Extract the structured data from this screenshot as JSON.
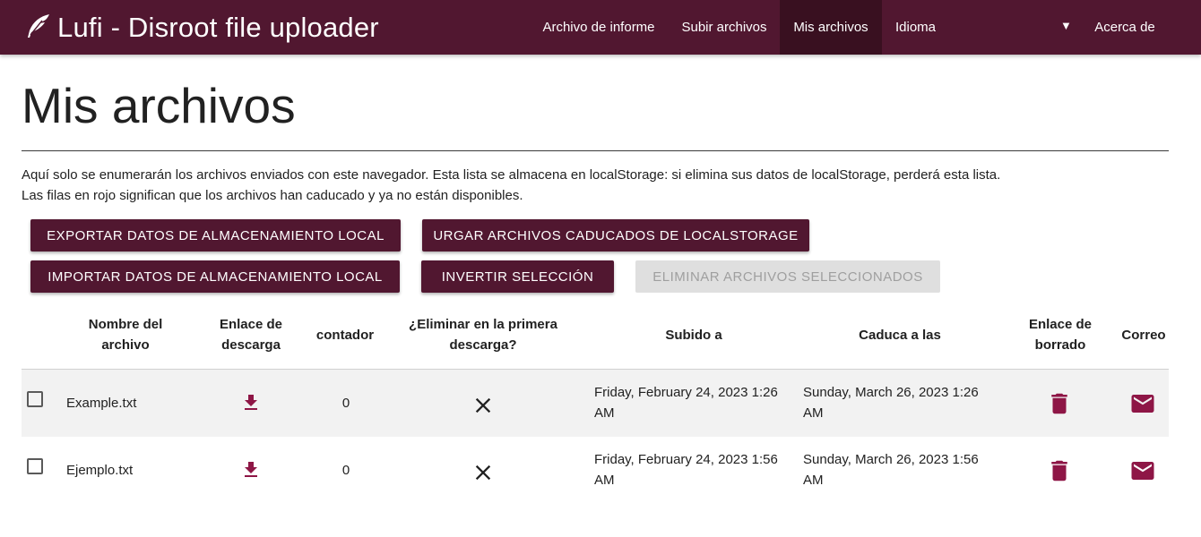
{
  "nav": {
    "brand": "Lufi - Disroot file uploader",
    "items": [
      {
        "label": "Archivo de informe"
      },
      {
        "label": "Subir archivos"
      },
      {
        "label": "Mis archivos",
        "active": true
      },
      {
        "label": "Acerca de"
      }
    ],
    "language": {
      "label": "Idioma",
      "caret": "▼"
    }
  },
  "page": {
    "title": "Mis archivos",
    "info_line1": "Aquí solo se enumerarán los archivos enviados con este navegador. Esta lista se almacena en localStorage: si elimina sus datos de localStorage, perderá esta lista.",
    "info_line2": "Las filas en rojo significan que los archivos han caducado y ya no están disponibles."
  },
  "buttons": {
    "export": "Exportar datos de almacenamiento local",
    "purge": "Urgar archivos caducados de localStorage",
    "import": "Importar datos de almacenamiento local",
    "invert": "Invertir selección",
    "delete_selected": "Eliminar archivos seleccionados"
  },
  "table": {
    "headers": {
      "name": [
        "Nombre del",
        "archivo"
      ],
      "download": [
        "Enlace de",
        "descarga"
      ],
      "counter": "contador",
      "delete_first": [
        "¿Eliminar en la primera",
        "descarga?"
      ],
      "uploaded": "Subido a",
      "expires": "Caduca a las",
      "deletion_link": [
        "Enlace de",
        "borrado"
      ],
      "mail": "Correo"
    },
    "rows": [
      {
        "name": "Example.txt",
        "counter": "0",
        "uploaded": [
          "Friday, February 24, 2023 1:26",
          "AM"
        ],
        "expires": [
          "Sunday, March 26, 2023 1:26",
          "AM"
        ]
      },
      {
        "name": "Ejemplo.txt",
        "counter": "0",
        "uploaded": [
          "Friday, February 24, 2023 1:56",
          "AM"
        ],
        "expires": [
          "Sunday, March 26, 2023 1:56",
          "AM"
        ]
      }
    ]
  },
  "colors": {
    "brand": "#511730",
    "active_nav": "#391020",
    "icon_accent": "#8e1646",
    "row_shade": "#f2f2f2"
  },
  "icons": {
    "brand": "feather-icon",
    "download": "download-icon",
    "delete_first": "close-icon",
    "deletion": "trash-icon",
    "mail": "mail-icon"
  }
}
